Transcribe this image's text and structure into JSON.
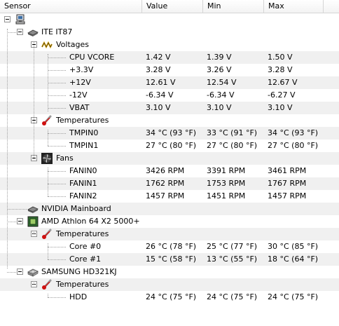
{
  "columns": [
    "Sensor",
    "Value",
    "Min",
    "Max"
  ],
  "computer_icon": "computer-icon",
  "tree": {
    "ite": {
      "name": "ITE IT87",
      "voltages": {
        "label": "Voltages",
        "rows": [
          {
            "name": "CPU VCORE",
            "value": "1.42 V",
            "min": "1.39 V",
            "max": "1.50 V"
          },
          {
            "name": "+3.3V",
            "value": "3.28 V",
            "min": "3.26 V",
            "max": "3.28 V"
          },
          {
            "name": "+12V",
            "value": "12.61 V",
            "min": "12.54 V",
            "max": "12.67 V"
          },
          {
            "name": "-12V",
            "value": "-6.34 V",
            "min": "-6.34 V",
            "max": "-6.27 V"
          },
          {
            "name": "VBAT",
            "value": "3.10 V",
            "min": "3.10 V",
            "max": "3.10 V"
          }
        ]
      },
      "temperatures": {
        "label": "Temperatures",
        "rows": [
          {
            "name": "TMPIN0",
            "value": "34 °C  (93 °F)",
            "min": "33 °C  (91 °F)",
            "max": "34 °C  (93 °F)"
          },
          {
            "name": "TMPIN1",
            "value": "27 °C  (80 °F)",
            "min": "27 °C  (80 °F)",
            "max": "27 °C  (80 °F)"
          }
        ]
      },
      "fans": {
        "label": "Fans",
        "rows": [
          {
            "name": "FANIN0",
            "value": "3426 RPM",
            "min": "3391 RPM",
            "max": "3461 RPM"
          },
          {
            "name": "FANIN1",
            "value": "1762 RPM",
            "min": "1753 RPM",
            "max": "1767 RPM"
          },
          {
            "name": "FANIN2",
            "value": "1457 RPM",
            "min": "1451 RPM",
            "max": "1457 RPM"
          }
        ]
      }
    },
    "nvidia": {
      "name": "NVIDIA Mainboard"
    },
    "amd": {
      "name": "AMD Athlon 64 X2 5000+",
      "temperatures": {
        "label": "Temperatures",
        "rows": [
          {
            "name": "Core #0",
            "value": "26 °C  (78 °F)",
            "min": "25 °C  (77 °F)",
            "max": "30 °C  (85 °F)"
          },
          {
            "name": "Core #1",
            "value": "15 °C  (58 °F)",
            "min": "13 °C  (55 °F)",
            "max": "18 °C  (64 °F)"
          }
        ]
      }
    },
    "samsung": {
      "name": "SAMSUNG HD321KJ",
      "temperatures": {
        "label": "Temperatures",
        "rows": [
          {
            "name": "HDD",
            "value": "24 °C  (75 °F)",
            "min": "24 °C  (75 °F)",
            "max": "24 °C  (75 °F)"
          }
        ]
      }
    }
  }
}
